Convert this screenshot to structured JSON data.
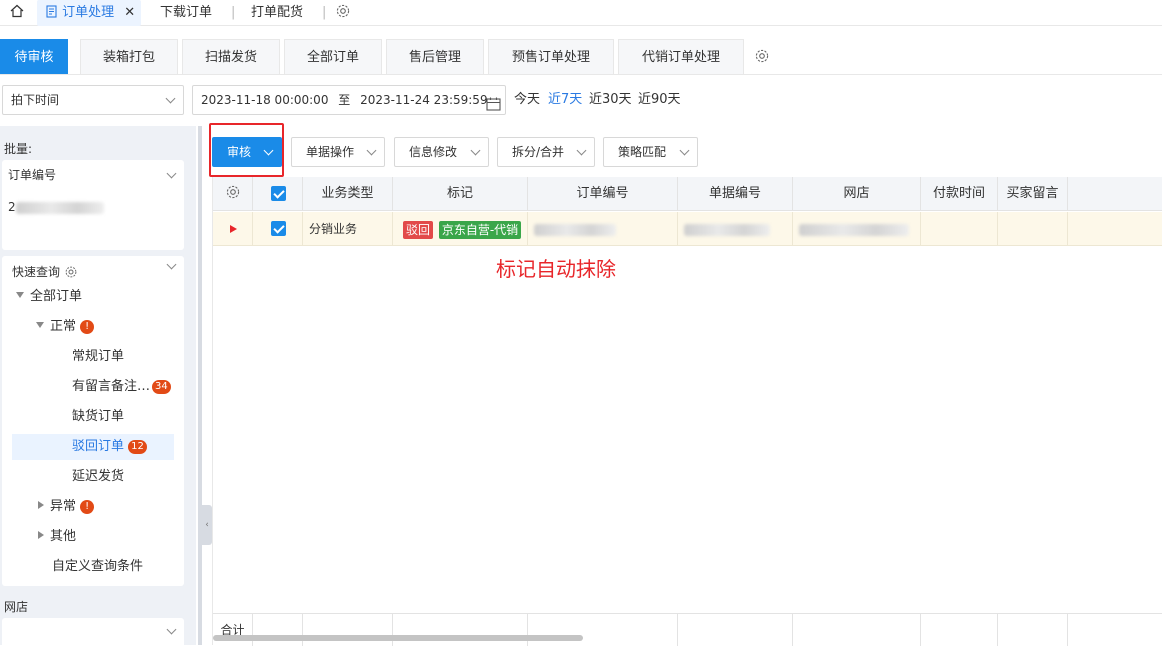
{
  "topbar": {
    "home_icon": "home-icon",
    "active_tab": "订单处理",
    "tabs": [
      "下载订单",
      "打单配货"
    ],
    "close_glyph": "✕"
  },
  "tabs": [
    "待审核",
    "装箱打包",
    "扫描发货",
    "全部订单",
    "售后管理",
    "预售订单处理",
    "代销订单处理"
  ],
  "datebar": {
    "time_type": "拍下时间",
    "start": "2023-11-18 00:00:00",
    "to": "至",
    "end": "2023-11-24 23:59:59",
    "quick": [
      "今天",
      "近7天",
      "近30天",
      "近90天"
    ]
  },
  "left": {
    "batch_label": "批量:",
    "order_no_select": "订单编号",
    "order_no_value": "2",
    "quick_query": "快速查询",
    "tree": {
      "all": "全部订单",
      "normal": "正常",
      "normal_badge": "!",
      "regular": "常规订单",
      "with_notes": "有留言备注…",
      "with_notes_badge": "34",
      "out_of_stock": "缺货订单",
      "rejected": "驳回订单",
      "rejected_badge": "12",
      "delayed": "延迟发货",
      "abnormal": "异常",
      "abnormal_badge": "!",
      "other": "其他",
      "custom": "自定义查询条件"
    },
    "shop_label": "网店"
  },
  "actions": [
    "审核",
    "单据操作",
    "信息修改",
    "拆分/合并",
    "策略匹配"
  ],
  "grid": {
    "columns": [
      "业务类型",
      "标记",
      "订单编号",
      "单据编号",
      "网店",
      "付款时间",
      "买家留言"
    ],
    "row": {
      "business_type": "分销业务",
      "tag_rejected": "驳回",
      "tag_jd": "京东自营-代销",
      "order_no": "…7427…9",
      "doc_no": "20…",
      "shop": "…"
    },
    "footer_total": "合计"
  },
  "annotation": "标记自动抹除",
  "colors": {
    "primary": "#1a8be8",
    "red": "#e8262a",
    "tag_rejected": "#e24a4a",
    "tag_jd": "#3aa64a"
  }
}
